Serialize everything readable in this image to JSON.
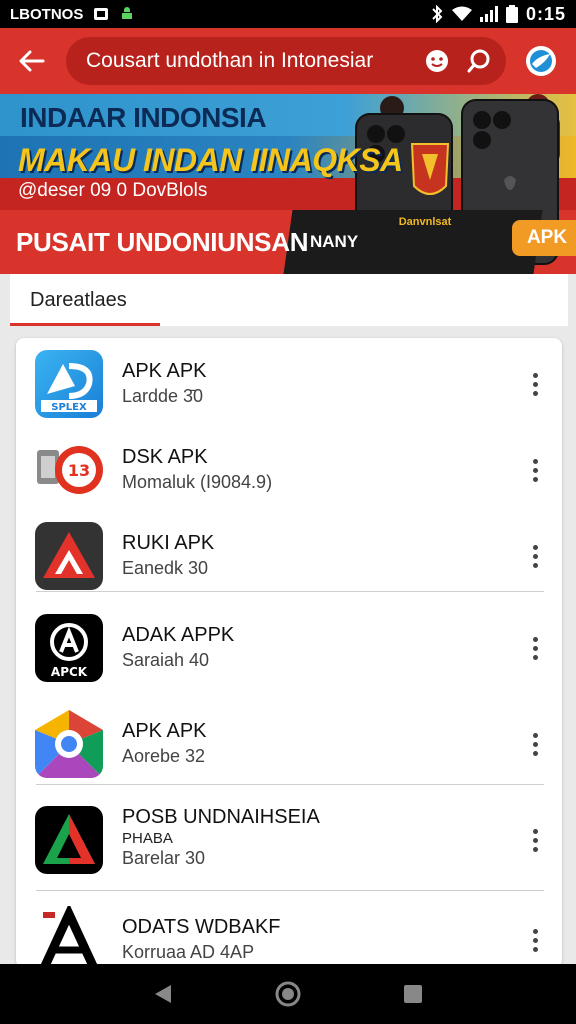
{
  "status_bar": {
    "carrier": "LBOTNOS",
    "time": "0:15",
    "icons": [
      "notification-icon",
      "android-icon",
      "bluetooth-icon",
      "wifi-icon",
      "signal-icon",
      "battery-icon"
    ]
  },
  "app_bar": {
    "search_query": "Cousart undothan  in Intonesiar",
    "icons": [
      "back-arrow-icon",
      "face-icon",
      "search-icon",
      "globe-icon"
    ]
  },
  "banner": {
    "line1": "INDAAR INDONSIA",
    "line2": "MAKAU INDAN IINAQKSA",
    "line3": "@deser 09 0 DovBlols",
    "line4": "PUSAIT UNDONIUNSAN",
    "panel_text": "NANY",
    "promo_text": "Danvnlsat",
    "apk_button": "APK"
  },
  "tabs": [
    {
      "label": "Dareatlaes",
      "active": true
    }
  ],
  "apps": [
    {
      "title": "APK APK",
      "subtitle": "Lardde 3̄0",
      "icon": "apk-splex-logo-icon"
    },
    {
      "title": "DSK APK",
      "subtitle": "Momaluk (I9084.9)",
      "icon": "dsk-bundle-icon"
    },
    {
      "title": "RUKI APK",
      "subtitle": "Eanedk 30",
      "icon": "red-triangle-logo-icon"
    },
    {
      "title": "ADAK APPK",
      "subtitle": "Saraiah 40",
      "icon": "apck-logo-icon"
    },
    {
      "title": "APK APK",
      "subtitle": "Aorebe 32",
      "icon": "colorful-chat-logo-icon"
    },
    {
      "title": "POSB UNDNAIHSEIA",
      "subtitle2": "PHABA",
      "subtitle": "Barelar 30",
      "icon": "green-triangle-logo-icon"
    },
    {
      "title": "ODATS WDBAKF",
      "subtitle": "Korruaa AD 4AP",
      "icon": "black-a-logo-icon"
    }
  ],
  "nav": [
    "back-nav-icon",
    "home-nav-icon",
    "recents-nav-icon"
  ],
  "colors": {
    "primary": "#d8342b",
    "primary_dark": "#b8221c",
    "accent": "#f19a24",
    "background": "#e9e9e9"
  }
}
